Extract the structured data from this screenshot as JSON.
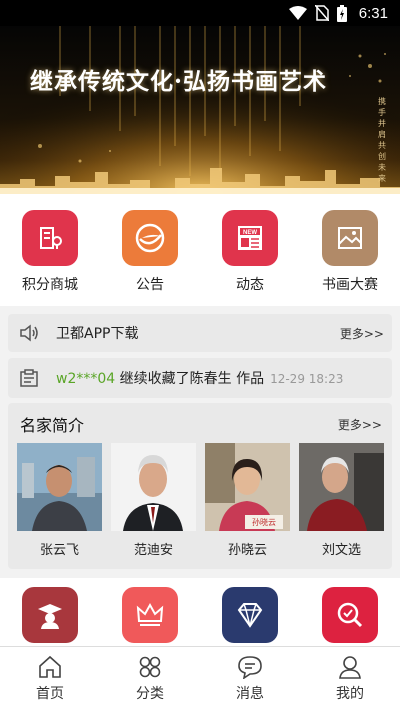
{
  "status_bar": {
    "time": "6:31",
    "icons": [
      "wifi-icon",
      "no-sim-icon",
      "battery-icon"
    ]
  },
  "banner": {
    "title": "继承传统文化·弘扬书画艺术",
    "vertical_text": "携手并肩共创未来"
  },
  "menu": [
    {
      "label": "积分商城",
      "icon": "points-mall-icon",
      "color": "#e0344c"
    },
    {
      "label": "公告",
      "icon": "announcement-icon",
      "color": "#ec7b3a"
    },
    {
      "label": "动态",
      "icon": "news-icon",
      "color": "#e0344c"
    },
    {
      "label": "书画大赛",
      "icon": "painting-contest-icon",
      "color": "#b18a68"
    }
  ],
  "notice_app": {
    "text": "卫都APP下载",
    "more": "更多>>"
  },
  "notice_activity": {
    "user": "w2***04",
    "text": "继续收藏了陈春生 作品",
    "time": "12-29 18:23"
  },
  "artists_section": {
    "title": "名家简介",
    "more": "更多>>",
    "artists": [
      {
        "name": "张云飞"
      },
      {
        "name": "范迪安"
      },
      {
        "name": "孙晓云"
      },
      {
        "name": "刘文选"
      }
    ]
  },
  "menu2": [
    {
      "icon": "graduate-icon",
      "color": "#a8373d"
    },
    {
      "icon": "crown-icon",
      "color": "#f0595a"
    },
    {
      "icon": "diamond-icon",
      "color": "#2a3a6e"
    },
    {
      "icon": "search-check-icon",
      "color": "#dd2240"
    }
  ],
  "tabbar": [
    {
      "label": "首页",
      "icon": "home-icon"
    },
    {
      "label": "分类",
      "icon": "category-icon"
    },
    {
      "label": "消息",
      "icon": "message-icon"
    },
    {
      "label": "我的",
      "icon": "profile-icon"
    }
  ]
}
